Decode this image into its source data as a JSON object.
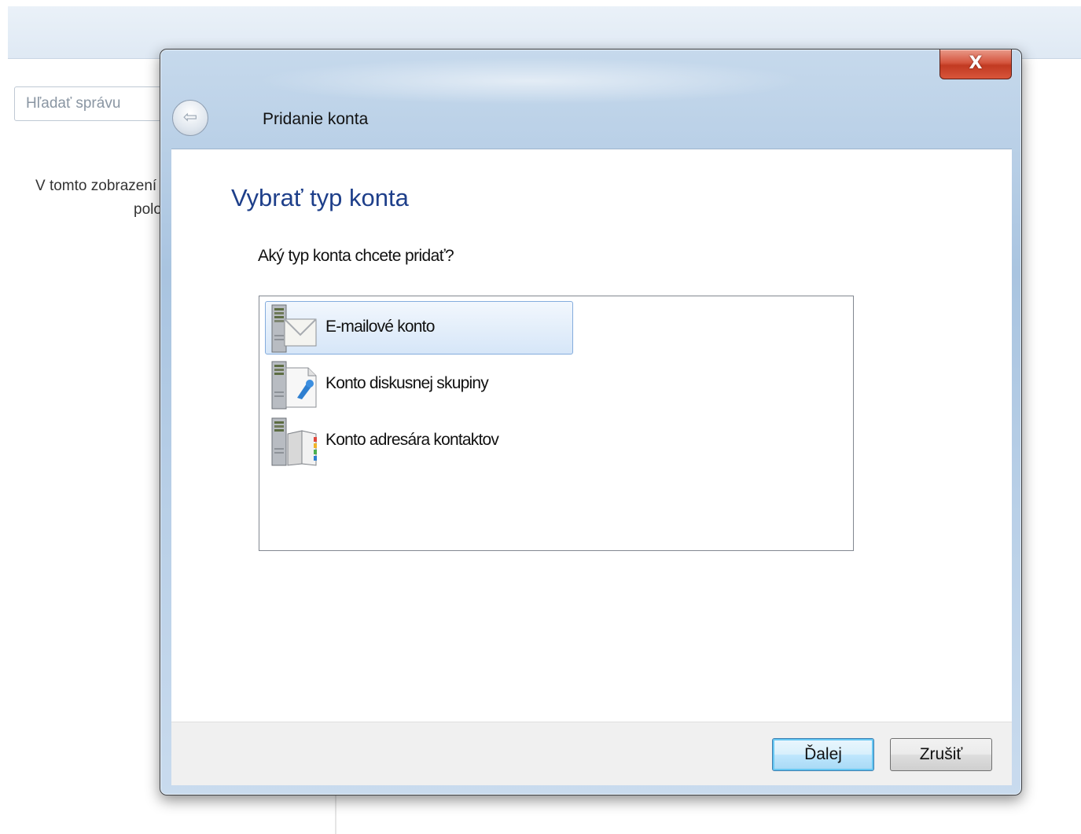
{
  "background_app": {
    "search_placeholder": "Hľadať správu",
    "message_line1": "V tomto zobrazení",
    "message_line2": "položky"
  },
  "dialog": {
    "title": "Pridanie konta",
    "close_label": "X",
    "heading": "Vybrať typ konta",
    "question": "Aký typ konta chcete pridať?",
    "account_types": [
      {
        "label": "E-mailové konto",
        "icon": "email-server-icon",
        "selected": true
      },
      {
        "label": "Konto diskusnej skupiny",
        "icon": "newsgroup-server-icon",
        "selected": false
      },
      {
        "label": "Konto adresára kontaktov",
        "icon": "directory-server-icon",
        "selected": false
      }
    ],
    "buttons": {
      "next": "Ďalej",
      "cancel": "Zrušiť"
    }
  }
}
